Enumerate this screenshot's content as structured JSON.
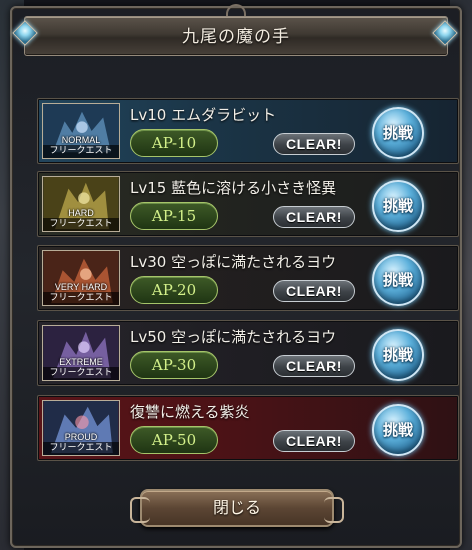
{
  "dialog": {
    "title": "九尾の魔の手",
    "close_label": "閉じる"
  },
  "quests": [
    {
      "name": "Lv10 エムダラビット",
      "difficulty": "NORMAL",
      "type": "フリークエスト",
      "ap": "AP-10",
      "status": "CLEAR!",
      "action": "挑戦",
      "color": "#2f6f95"
    },
    {
      "name": "Lv15 藍色に溶ける小さき怪異",
      "difficulty": "HARD",
      "type": "フリークエスト",
      "ap": "AP-15",
      "status": "CLEAR!",
      "action": "挑戦",
      "color": "#8a7a2a"
    },
    {
      "name": "Lv30 空っぽに満たされるヨウ",
      "difficulty": "VERY HARD",
      "type": "フリークエスト",
      "ap": "AP-20",
      "status": "CLEAR!",
      "action": "挑戦",
      "color": "#8a4a32"
    },
    {
      "name": "Lv50 空っぽに満たされるヨウ",
      "difficulty": "EXTREME",
      "type": "フリークエスト",
      "ap": "AP-30",
      "status": "CLEAR!",
      "action": "挑戦",
      "color": "#5a3f78"
    },
    {
      "name": "復讐に燃える紫炎",
      "difficulty": "PROUD",
      "type": "フリークエスト",
      "ap": "AP-50",
      "status": "CLEAR!",
      "action": "挑戦",
      "color": "#3a4f7a"
    }
  ],
  "icons": {
    "gem": "diamond-gem-icon",
    "ornament": "frame-ornament-icon"
  }
}
